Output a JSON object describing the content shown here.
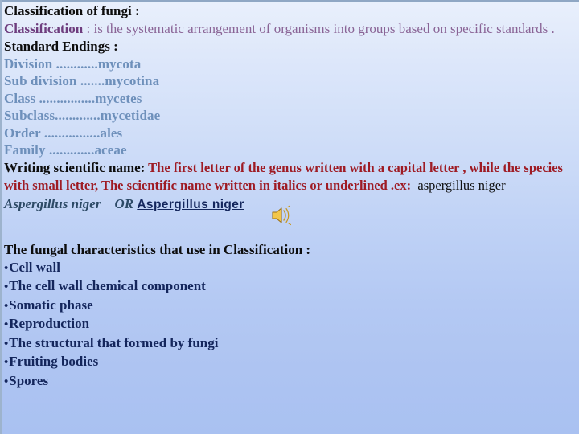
{
  "slide": {
    "background_top": "#e9f0fc",
    "background_bottom": "#a9c1f1",
    "border_color": "#8fa7c4"
  },
  "title": {
    "text": "Classification of fungi :",
    "color": "#0d0d0d"
  },
  "definition": {
    "term": "Classification",
    "separator": " : ",
    "body": "is the systematic arrangement of organisms into groups based on specific standards .",
    "term_color": "#6e3d7e",
    "body_color": "#8a6496"
  },
  "standard_endings": {
    "heading": "Standard Endings :",
    "heading_color": "#0d0d0d",
    "color": "#6e90bb",
    "ranks": [
      {
        "rank": "Division",
        "dots": " ............",
        "ending": "mycota"
      },
      {
        "rank": "Sub division",
        "dots": " .......",
        "ending": "mycotina"
      },
      {
        "rank": "Class",
        "dots": " ................",
        "ending": "mycetes"
      },
      {
        "rank": "Subclass",
        "dots": ".............",
        "ending": "mycetidae"
      },
      {
        "rank": "Order",
        "dots": " ................",
        "ending": "ales"
      },
      {
        "rank": "Family",
        "dots": " .............",
        "ending": "aceae"
      }
    ]
  },
  "writing_rule": {
    "label": "Writing scientific name:",
    "label_color": "#0d0d0d",
    "rule_part1": "The first letter of the genus written with a capital letter , while the species with small letter, The scientific name written in ",
    "rule_italic": "italics",
    "rule_part2": " or underlined .ex:",
    "rule_color": "#9e1b24",
    "example_plain": "aspergillus niger",
    "example_plain_color": "#101010"
  },
  "example_line": {
    "italic_name": "Aspergillus niger",
    "connector": "OR",
    "underlined_name": "Aspergillus niger",
    "italic_color": "#2d4a66",
    "underlined_color": "#14265c"
  },
  "sound_icon": {
    "name": "sound-speaker-icon",
    "body_color": "#f2c64a",
    "edge_color": "#b07d17",
    "wave_color": "#c8961e"
  },
  "characteristics": {
    "heading": "The fungal characteristics  that  use in Classification :",
    "heading_color": "#0d0d0d",
    "bullet_glyph": "•",
    "bullet_color": "#14265c",
    "items": [
      "Cell wall",
      "The cell wall chemical component",
      "Somatic phase",
      "Reproduction",
      "The structural that formed by fungi",
      "Fruiting bodies",
      "Spores"
    ]
  }
}
